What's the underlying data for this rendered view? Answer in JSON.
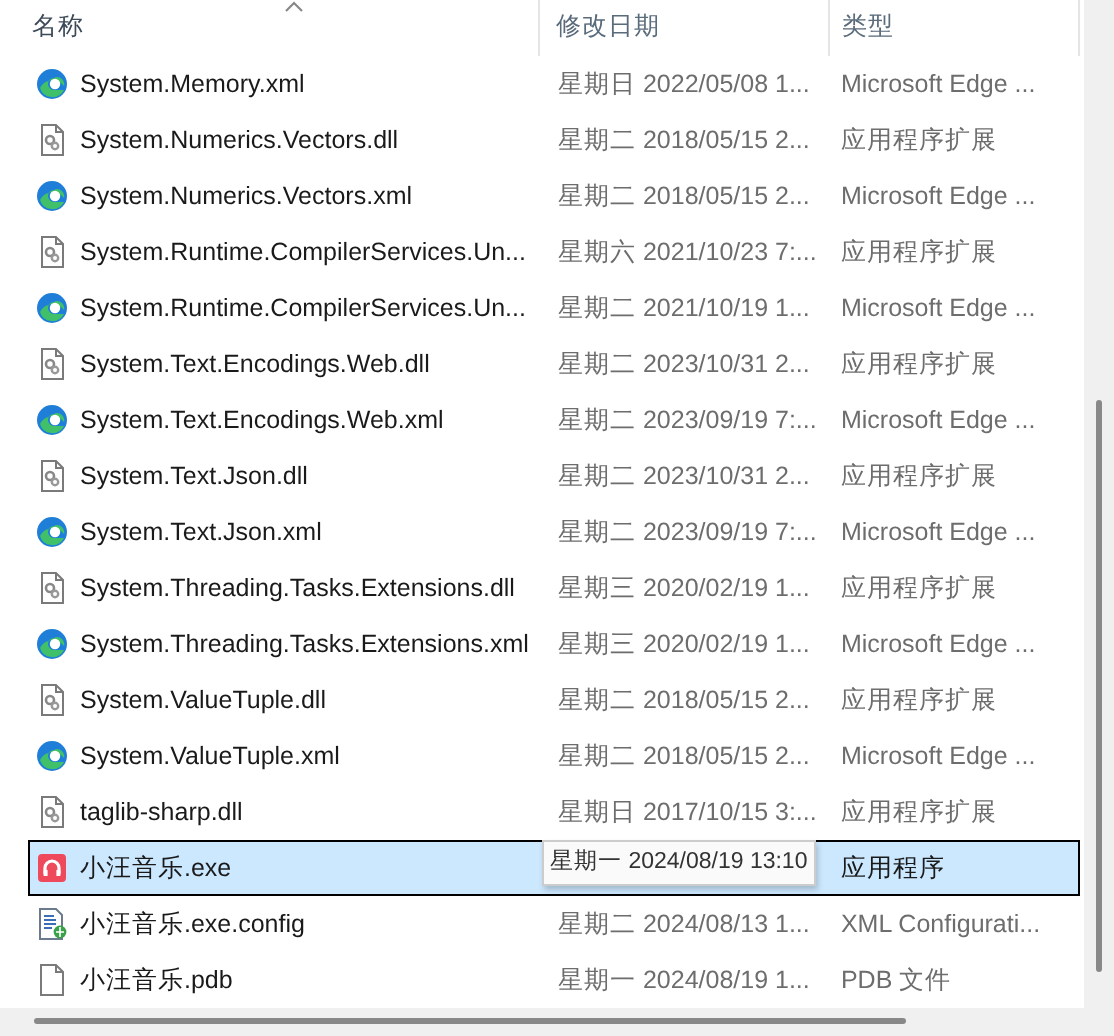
{
  "header": {
    "columns": [
      {
        "label": "名称",
        "sorted": true
      },
      {
        "label": "修改日期",
        "sorted": false
      },
      {
        "label": "类型",
        "sorted": false
      }
    ]
  },
  "rows": [
    {
      "kind": "edge",
      "name": "System.Memory.xml",
      "date": "星期日 2022/05/08 1...",
      "type": "Microsoft Edge ...",
      "selected": false
    },
    {
      "kind": "dll",
      "name": "System.Numerics.Vectors.dll",
      "date": "星期二 2018/05/15 2...",
      "type": "应用程序扩展",
      "selected": false
    },
    {
      "kind": "edge",
      "name": "System.Numerics.Vectors.xml",
      "date": "星期二 2018/05/15 2...",
      "type": "Microsoft Edge ...",
      "selected": false
    },
    {
      "kind": "dll",
      "name": "System.Runtime.CompilerServices.Un...",
      "date": "星期六 2021/10/23 7:...",
      "type": "应用程序扩展",
      "selected": false
    },
    {
      "kind": "edge",
      "name": "System.Runtime.CompilerServices.Un...",
      "date": "星期二 2021/10/19 1...",
      "type": "Microsoft Edge ...",
      "selected": false
    },
    {
      "kind": "dll",
      "name": "System.Text.Encodings.Web.dll",
      "date": "星期二 2023/10/31 2...",
      "type": "应用程序扩展",
      "selected": false
    },
    {
      "kind": "edge",
      "name": "System.Text.Encodings.Web.xml",
      "date": "星期二 2023/09/19 7:...",
      "type": "Microsoft Edge ...",
      "selected": false
    },
    {
      "kind": "dll",
      "name": "System.Text.Json.dll",
      "date": "星期二 2023/10/31 2...",
      "type": "应用程序扩展",
      "selected": false
    },
    {
      "kind": "edge",
      "name": "System.Text.Json.xml",
      "date": "星期二 2023/09/19 7:...",
      "type": "Microsoft Edge ...",
      "selected": false
    },
    {
      "kind": "dll",
      "name": "System.Threading.Tasks.Extensions.dll",
      "date": "星期三 2020/02/19 1...",
      "type": "应用程序扩展",
      "selected": false
    },
    {
      "kind": "edge",
      "name": "System.Threading.Tasks.Extensions.xml",
      "date": "星期三 2020/02/19 1...",
      "type": "Microsoft Edge ...",
      "selected": false
    },
    {
      "kind": "dll",
      "name": "System.ValueTuple.dll",
      "date": "星期二 2018/05/15 2...",
      "type": "应用程序扩展",
      "selected": false
    },
    {
      "kind": "edge",
      "name": "System.ValueTuple.xml",
      "date": "星期二 2018/05/15 2...",
      "type": "Microsoft Edge ...",
      "selected": false
    },
    {
      "kind": "dll",
      "name": "taglib-sharp.dll",
      "date": "星期日 2017/10/15 3:...",
      "type": "应用程序扩展",
      "selected": false
    },
    {
      "kind": "exe",
      "name": "小汪音乐.exe",
      "type": "应用程序",
      "selected": true
    },
    {
      "kind": "config",
      "name": "小汪音乐.exe.config",
      "date": "星期二 2024/08/13 1...",
      "type": "XML Configurati...",
      "selected": false
    },
    {
      "kind": "file",
      "name": "小汪音乐.pdb",
      "date": "星期一 2024/08/19 1...",
      "type": "PDB 文件",
      "selected": false
    }
  ],
  "tooltip": {
    "text": "星期一 2024/08/19 13:10"
  }
}
